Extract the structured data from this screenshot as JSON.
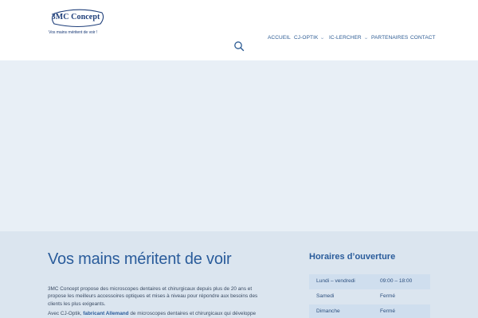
{
  "logo": {
    "name": "3MC Concept",
    "tagline": "Vos mains méritent de voir !"
  },
  "nav": {
    "items": [
      {
        "label": "ACCUEIL",
        "dropdown": false
      },
      {
        "label": "CJ-OPTIK",
        "dropdown": true
      },
      {
        "label": "IC-LERCHER",
        "dropdown": true
      },
      {
        "label": "PARTENAIRES",
        "dropdown": false
      },
      {
        "label": "CONTACT",
        "dropdown": false
      }
    ]
  },
  "main": {
    "title": "Vos mains méritent de voir",
    "intro": "3MC Concept propose des microscopes dentaires et chirurgicaux depuis plus de 20 ans et propose les meilleurs accessoires optiques et mises à niveau pour répondre aux besoins des clients les plus exigeants.",
    "intro2_prefix": "Avec CJ-Optik, ",
    "intro2_link": "fabricant Allemand",
    "intro2_suffix": " de microscopes dentaires et chirurgicaux qui développe"
  },
  "hours": {
    "title": "Horaires d’ouverture",
    "rows": [
      {
        "day": "Lundi – vendredi",
        "time": "09:00 – 18:00"
      },
      {
        "day": "Samedi",
        "time": "Fermé"
      },
      {
        "day": "Dimanche",
        "time": "Fermé"
      }
    ]
  },
  "colors": {
    "brand": "#1f3f7a",
    "accent": "#2a5c9b",
    "hero_bg": "#e8eff6",
    "content_bg": "#dbe5ef"
  }
}
